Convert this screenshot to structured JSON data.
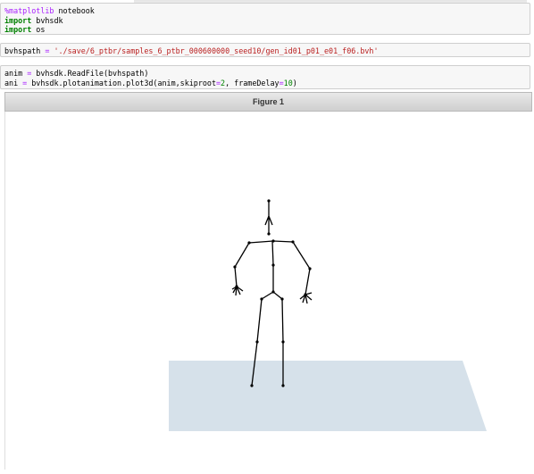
{
  "cells": {
    "cell1": {
      "line1": "%matplotlib notebook",
      "line2": "import bvhsdk",
      "line3": "import os"
    },
    "cell2": {
      "line1": "bvhspath = './save/6_ptbr/samples_6_ptbr_000600000_seed10/gen_id01_p01_e01_f06.bvh'"
    },
    "cell3": {
      "line1": "anim = bvhsdk.ReadFile(bvhspath)",
      "line2": "ani = bvhsdk.plotanimation.plot3d(anim,skiproot=2, frameDelay=10)"
    }
  },
  "figure": {
    "title": "Figure 1",
    "floor_color": "#d6e1ea",
    "skeleton_color": "#000000"
  }
}
